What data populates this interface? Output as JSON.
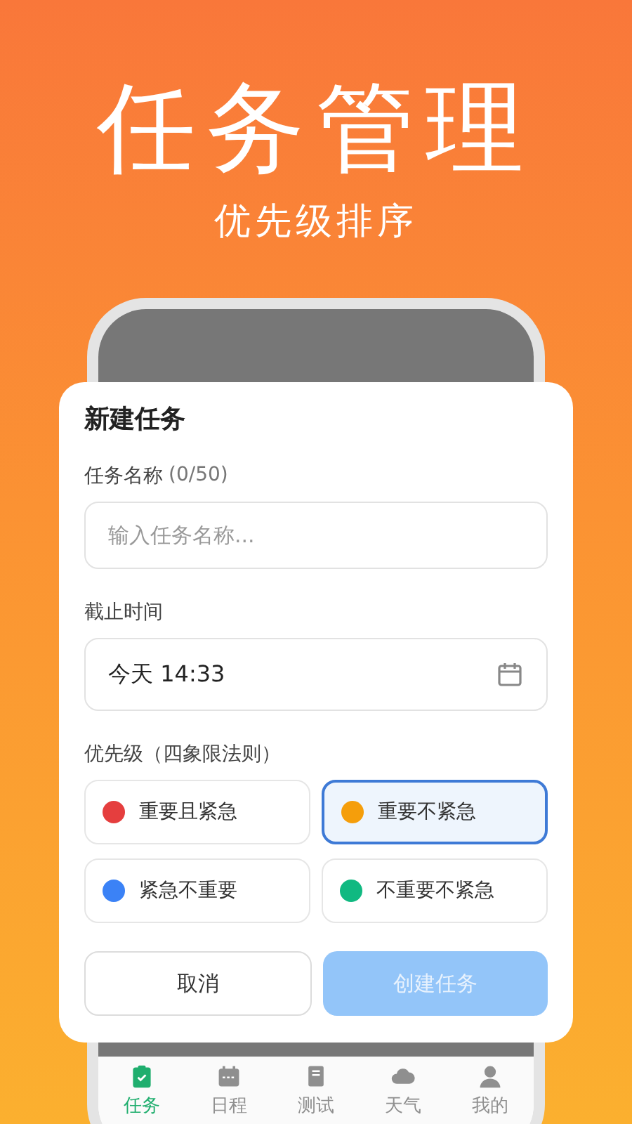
{
  "headline": "任务管理",
  "subtitle": "优先级排序",
  "dialog": {
    "title": "新建任务",
    "name_label": "任务名称",
    "name_count": "(0/50)",
    "name_field": {
      "placeholder": "输入任务名称..."
    },
    "deadline_label": "截止时间",
    "deadline_field": {
      "value": "今天 14:33"
    },
    "priority_label": "优先级（四象限法则）",
    "priorities": [
      {
        "label": "重要且紧急",
        "color": "#e53e3e",
        "selected": false
      },
      {
        "label": "重要不紧急",
        "color": "#f59e0b",
        "selected": true
      },
      {
        "label": "紧急不重要",
        "color": "#3b82f6",
        "selected": false
      },
      {
        "label": "不重要不紧急",
        "color": "#10b981",
        "selected": false
      }
    ],
    "buttons": [
      {
        "label": "取消",
        "kind": "secondary",
        "disabled": false
      },
      {
        "label": "创建任务",
        "kind": "primary",
        "disabled": true
      }
    ]
  },
  "nav": [
    {
      "label": "任务",
      "kind": "tasks",
      "selected": true
    },
    {
      "label": "日程",
      "kind": "calendar",
      "selected": false
    },
    {
      "label": "测试",
      "kind": "book",
      "selected": false
    },
    {
      "label": "天气",
      "kind": "cloud",
      "selected": false
    },
    {
      "label": "我的",
      "kind": "profile",
      "selected": false
    }
  ]
}
